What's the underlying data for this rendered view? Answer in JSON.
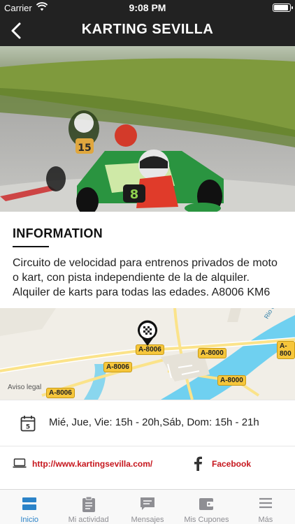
{
  "status_bar": {
    "carrier": "Carrier",
    "time": "9:08 PM"
  },
  "navbar": {
    "title": "KARTING SEVILLA",
    "back_icon": "chevron-left-icon"
  },
  "info": {
    "heading": "INFORMATION",
    "description": "Circuito de velocidad para entrenos privados de moto o kart, con pista independiente de la de alquiler. Alquiler de karts para todas las edades. A8006 KM6"
  },
  "map": {
    "legal": "Aviso legal",
    "road_labels": [
      "A-8006",
      "A-8006",
      "A-8006",
      "A-8000",
      "A-8000",
      "A-800"
    ],
    "river_label": "Rio Gu",
    "marker_icon": "checkered-flag-pin-icon"
  },
  "details": {
    "hours": "Mié, Jue, Vie: 15h - 20h,Sáb, Dom: 15h - 21h",
    "website": "http://www.kartingsevilla.com/",
    "facebook": "Facebook"
  },
  "tabbar": {
    "tabs": [
      {
        "label": "Inicio",
        "icon": "home-icon",
        "active": true
      },
      {
        "label": "Mi actividad",
        "icon": "clipboard-icon",
        "active": false
      },
      {
        "label": "Mensajes",
        "icon": "message-icon",
        "active": false
      },
      {
        "label": "Mis Cupones",
        "icon": "wallet-icon",
        "active": false
      },
      {
        "label": "Más",
        "icon": "menu-icon",
        "active": false
      }
    ]
  },
  "colors": {
    "header_bg": "#222222",
    "link_red": "#c6161d",
    "tab_active": "#2b83c8",
    "tab_inactive": "#8e8e93"
  }
}
